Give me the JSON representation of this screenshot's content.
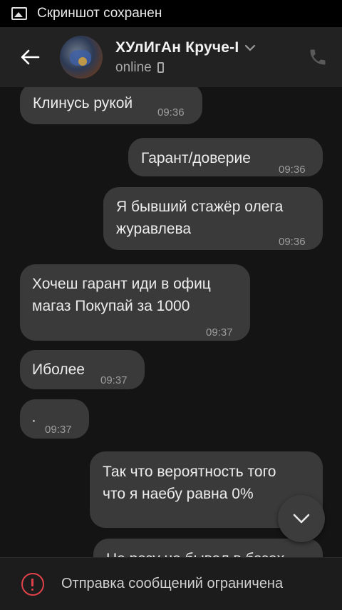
{
  "statusbar": {
    "text": "Скриншот сохранен",
    "icon": "image-icon"
  },
  "header": {
    "title": "ХУлИгАн Круче-I",
    "status": "online",
    "icons": {
      "back": "arrow-left-icon",
      "dropdown": "chevron-down-icon",
      "device": "mobile-phone-icon",
      "call": "phone-call-icon"
    }
  },
  "messages": [
    {
      "side": "in",
      "text": "Клинусь рукой",
      "time": "09:36"
    },
    {
      "side": "out",
      "text": "Гарант/доверие",
      "time": "09:36"
    },
    {
      "side": "out",
      "line1": "Я бывший стажёр олега",
      "line2": "журавлева",
      "time": "09:36"
    },
    {
      "side": "in",
      "line1": "Хочеш гарант иди в офиц",
      "line2": "магаз Покупай за 1000",
      "time": "09:37"
    },
    {
      "side": "in",
      "text": "Иболее",
      "time": "09:37"
    },
    {
      "side": "in",
      "text": "·",
      "time": "09:37"
    },
    {
      "side": "out",
      "line1": "Так что вероятность того",
      "line2": "что я наебу равна 0%"
    },
    {
      "side": "out",
      "text": "Не разу не бывал в базах"
    }
  ],
  "bottom": {
    "text": "Отправка сообщений ограничена",
    "icon": "alert-circle-icon"
  },
  "colors": {
    "bubble": "#3a3a3a",
    "header": "#222222",
    "background": "#141414",
    "warning": "#e0424a"
  }
}
